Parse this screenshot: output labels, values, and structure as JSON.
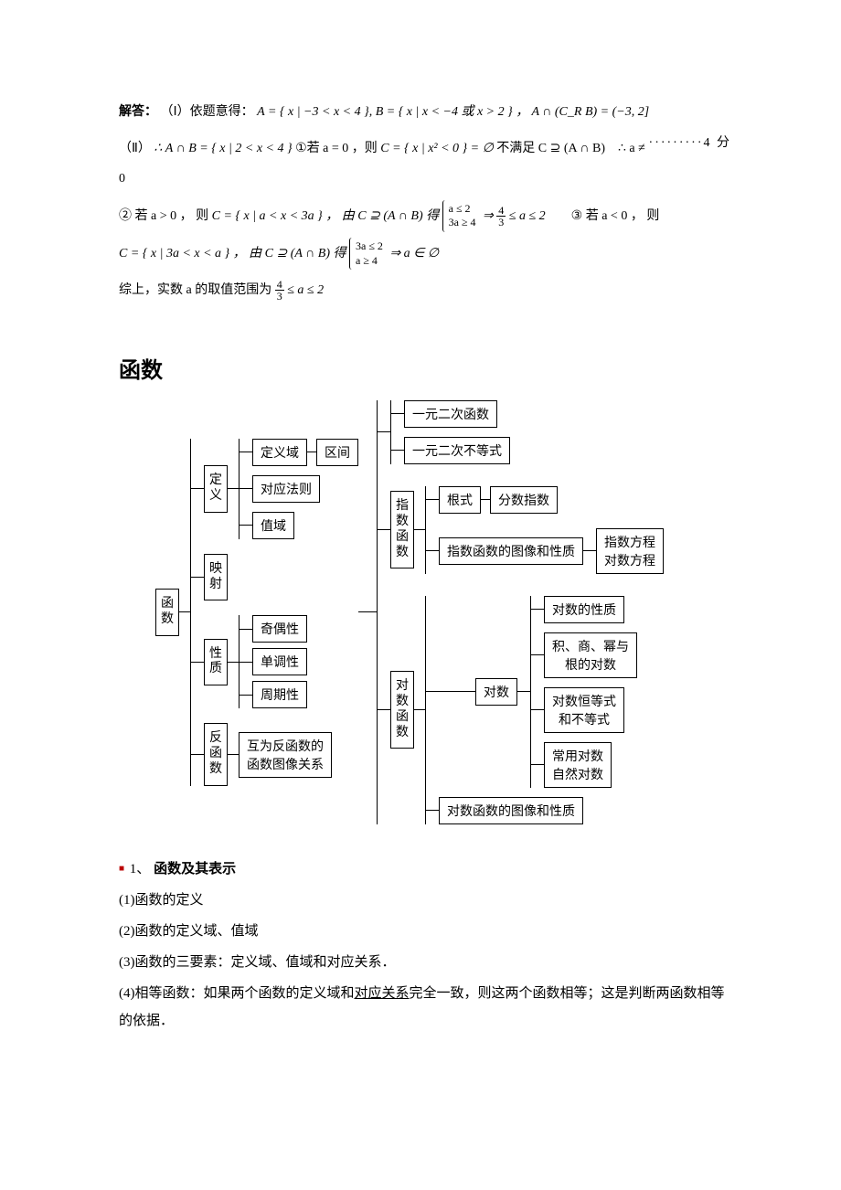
{
  "solution": {
    "label": "解答：",
    "p1_prefix": "（Ⅰ）依题意得：",
    "p1_sets": "A = { x | −3 < x < 4 }, B = { x | x < −4 或 x > 2 } ， A ∩ (C_R B) = (−3, 2]",
    "p1_score": "·········4 分",
    "p2_prefix": "（Ⅱ）",
    "p2_therefore": "∴ A ∩ B = { x | 2 < x < 4 }",
    "p2_case1_label": "①若 a = 0 ，则",
    "p2_case1_set": "C = { x | x² < 0 } = ∅",
    "p2_case1_tail": "不满足 C ⊇ (A ∩ B)　∴ a ≠ 0",
    "p3_case2_label": "② 若 a > 0 ， 则",
    "p3_case2_set": "C = { x | a < x < 3a } ， 由 C ⊇ (A ∩ B) 得",
    "p3_case2_brace_top": "a ≤ 2",
    "p3_case2_brace_bot": "3a ≥ 4",
    "p3_case2_arrow": "⇒",
    "p3_case2_frac_n": "4",
    "p3_case2_frac_d": "3",
    "p3_case2_tail": "≤ a ≤ 2",
    "p3_case3_label": "③ 若 a < 0 ， 则",
    "p4_set": "C = { x | 3a < x < a } ， 由 C ⊇ (A ∩ B) 得",
    "p4_brace_top": "3a ≤ 2",
    "p4_brace_bot": "a ≥ 4",
    "p4_arrow_tail": "⇒ a ∈ ∅",
    "p5_prefix": "综上，实数 a 的取值范围为",
    "p5_frac_n": "4",
    "p5_frac_d": "3",
    "p5_tail": "≤ a ≤ 2"
  },
  "section_title": "函数",
  "diagram": {
    "root": "函\n数",
    "l1": {
      "dy": "定\n义",
      "ys": "映\n射",
      "xz": "性\n质",
      "fh": "反\n函\n数"
    },
    "dy_children": {
      "dyy": "定义域",
      "qj": "区间",
      "dyfz": "对应法则",
      "zy": "值域"
    },
    "xz_children": {
      "qox": "奇偶性",
      "ddx": "单调性",
      "zqx": "周期性"
    },
    "fh_child": "互为反函数的\n函数图像关系",
    "right_top": {
      "yyec": "一元二次函数",
      "yyebd": "一元二次不等式"
    },
    "zshs_label": "指\n数\n函\n数",
    "zshs_children": {
      "gs": "根式",
      "fszs": "分数指数",
      "zstx": "指数函数的图像和性质"
    },
    "eq_box": "指数方程\n对数方程",
    "dshs_label": "对\n数\n函\n数",
    "ds_mid": "对数",
    "ds_props": {
      "xq": "对数的性质",
      "jsmg": "积、商、幂与\n根的对数",
      "hds": "对数恒等式\n和不等式",
      "cyds": "常用对数\n自然对数"
    },
    "dshs_img": "对数函数的图像和性质"
  },
  "notes": {
    "n1_num": "1、",
    "n1_title": "函数及其表示",
    "n1a": "(1)函数的定义",
    "n1b": "(2)函数的定义域、值域",
    "n1c": "(3)函数的三要素：定义域、值域和对应关系．",
    "n1d_pre": "(4)相等函数：如果两个函数的定义域和",
    "n1d_ul": "对应关系",
    "n1d_post": "完全一致，则这两个函数相等；这是判断两函数相等的依据．"
  }
}
